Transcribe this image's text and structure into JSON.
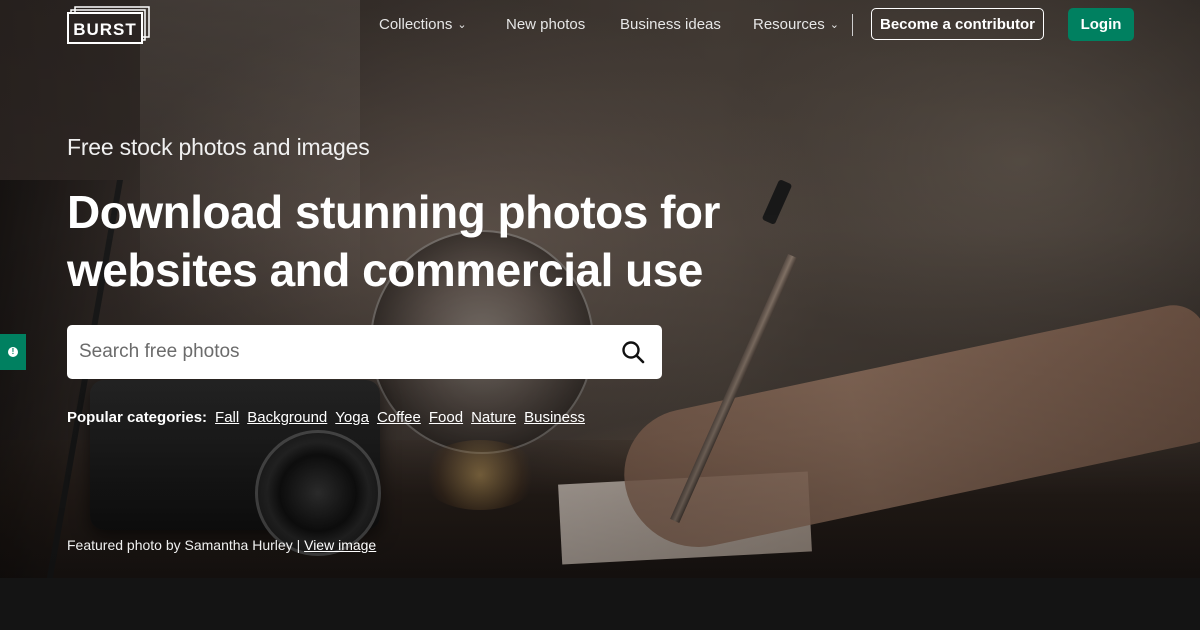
{
  "brand": {
    "logo_text": "BURST"
  },
  "nav": {
    "items": [
      {
        "label": "Collections",
        "has_dropdown": true
      },
      {
        "label": "New photos",
        "has_dropdown": false
      },
      {
        "label": "Business ideas",
        "has_dropdown": false
      },
      {
        "label": "Resources",
        "has_dropdown": true
      }
    ],
    "contributor_button": "Become a contributor",
    "login_button": "Login"
  },
  "hero": {
    "eyebrow": "Free stock photos and images",
    "headline": "Download stunning photos for websites and commercial use",
    "search": {
      "placeholder": "Search free photos",
      "value": ""
    },
    "categories_label": "Popular categories:",
    "categories": [
      "Fall",
      "Background",
      "Yoga",
      "Coffee",
      "Food",
      "Nature",
      "Business"
    ],
    "credit_prefix": "Featured photo by Samantha Hurley |",
    "credit_link": "View image"
  },
  "colors": {
    "accent_green": "#008060",
    "text_white": "#ffffff",
    "page_dark": "#141414"
  },
  "icons": {
    "search": "search-icon",
    "dropdown": "chevron-down-icon",
    "feedback": "feedback-icon"
  }
}
